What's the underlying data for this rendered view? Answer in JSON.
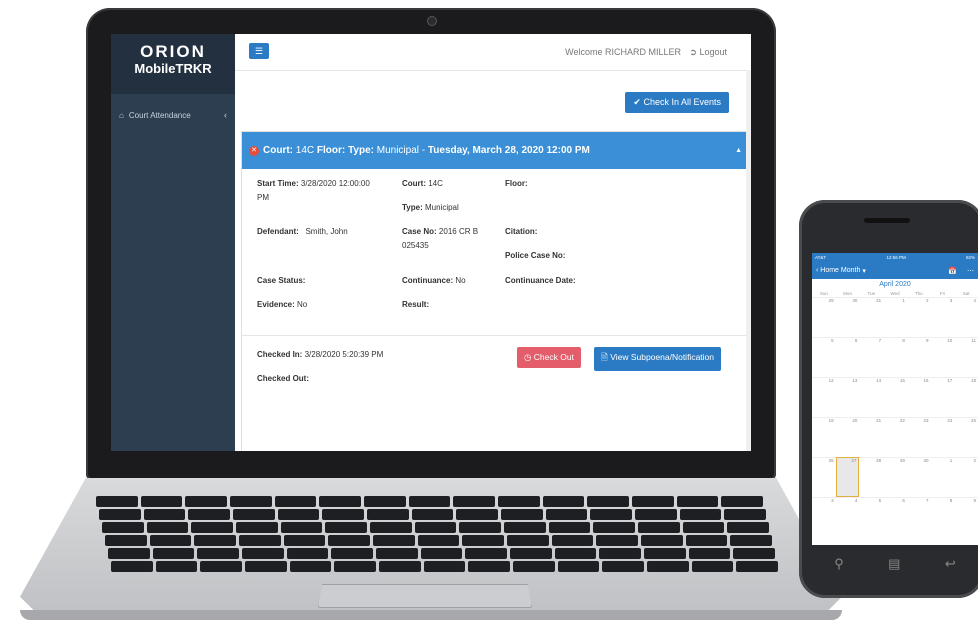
{
  "app": {
    "brand_line1": "ORION",
    "brand_line2": "MobileTRKR"
  },
  "sidebar": {
    "items": [
      {
        "label": "Court Attendance",
        "icon": "home-icon"
      }
    ]
  },
  "topbar": {
    "welcome": "Welcome RICHARD MILLER",
    "logout": "Logout"
  },
  "actions": {
    "check_in_all": "Check In All Events"
  },
  "event": {
    "header_court_label": "Court:",
    "header_court_value": "14C",
    "header_floor_label": "Floor:",
    "header_type_label": "Type:",
    "header_type_value": "Municipal",
    "header_sep": "-",
    "header_datetime": "Tuesday, March 28, 2020 12:00 PM",
    "start_time_label": "Start Time:",
    "start_time_value": "3/28/2020 12:00:00 PM",
    "court_label": "Court:",
    "court_value": "14C",
    "type_label": "Type:",
    "type_value": "Municipal",
    "floor_label": "Floor:",
    "defendant_label": "Defendant:",
    "defendant_value": "Smith, John",
    "case_no_label": "Case No:",
    "case_no_value": "2016 CR B 025435",
    "citation_label": "Citation:",
    "police_case_label": "Police Case No:",
    "case_status_label": "Case Status:",
    "continuance_label": "Continuance:",
    "continuance_value": "No",
    "continuance_date_label": "Continuance Date:",
    "evidence_label": "Evidence:",
    "evidence_value": "No",
    "result_label": "Result:",
    "checked_in_label": "Checked In:",
    "checked_in_value": "3/28/2020 5:20:39 PM",
    "checked_out_label": "Checked Out:",
    "check_out_button": "Check Out",
    "view_subpoena_button": "View Subpoena/Notification"
  },
  "phone": {
    "status_carrier": "AT&T",
    "status_time": "12:56 PM",
    "status_battery": "92%",
    "nav_back": "Home",
    "nav_title": "Month",
    "month_title": "April 2020",
    "weekdays": [
      "Sun",
      "Mon",
      "Tue",
      "Wed",
      "Thu",
      "Fri",
      "Sat"
    ],
    "weeks": [
      [
        "29",
        "30",
        "31",
        "1",
        "2",
        "3",
        "4"
      ],
      [
        "5",
        "6",
        "7",
        "8",
        "9",
        "10",
        "11"
      ],
      [
        "12",
        "13",
        "14",
        "15",
        "16",
        "17",
        "18"
      ],
      [
        "19",
        "20",
        "21",
        "22",
        "23",
        "24",
        "25"
      ],
      [
        "26",
        "27",
        "28",
        "29",
        "30",
        "1",
        "2"
      ],
      [
        "3",
        "4",
        "5",
        "6",
        "7",
        "8",
        "9"
      ]
    ],
    "today": "27"
  },
  "colors": {
    "primary": "#2b7bc4",
    "sidebar": "#2c3e50",
    "danger": "#e35d6a",
    "header_blue": "#3a8fd6"
  }
}
